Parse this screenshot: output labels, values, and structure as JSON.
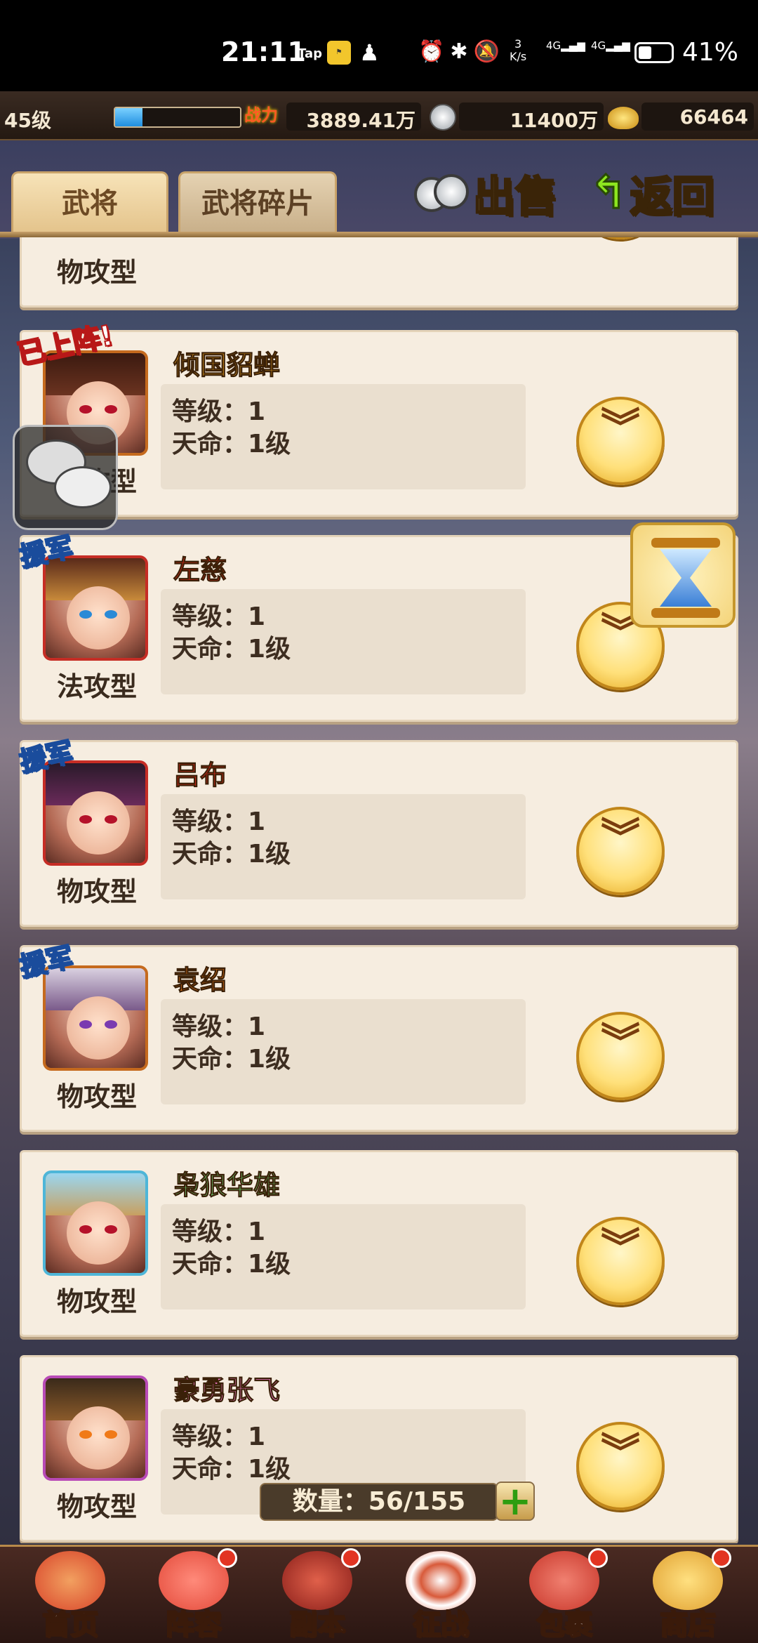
{
  "status_bar": {
    "time": "21:11",
    "tap_label": "Tap",
    "net_speed_top": "3",
    "net_speed_unit": "K/s",
    "sig1": "4G",
    "sig2": "4G",
    "battery": "41%",
    "battery_fraction": 0.41
  },
  "resources": {
    "level": "45级",
    "exp_fraction": 0.22,
    "power_label": "战力",
    "power_value": "3889.41万",
    "silver_value": "11400万",
    "gold_value": "66464"
  },
  "tabs": [
    {
      "label": "武将",
      "active": true
    },
    {
      "label": "武将碎片",
      "active": false
    }
  ],
  "actions": {
    "sell_label": "出售",
    "back_label": "返回"
  },
  "cards": [
    {
      "name": "",
      "type": "物攻型",
      "level_label": "等级：",
      "level": "1",
      "destiny_label": "天命：",
      "destiny": "1级",
      "badge": "",
      "name_color": "#000000"
    },
    {
      "name": "倾国貂蝉",
      "type": "物攻型",
      "level_label": "等级：",
      "level": "1",
      "destiny_label": "天命：",
      "destiny": "1级",
      "badge": "已上阵!",
      "name_color": "#e8a020"
    },
    {
      "name": "左慈",
      "type": "法攻型",
      "level_label": "等级：",
      "level": "1",
      "destiny_label": "天命：",
      "destiny": "1级",
      "badge": "援军",
      "name_color": "#e0261a"
    },
    {
      "name": "吕布",
      "type": "物攻型",
      "level_label": "等级：",
      "level": "1",
      "destiny_label": "天命：",
      "destiny": "1级",
      "badge": "援军",
      "name_color": "#e0261a"
    },
    {
      "name": "袁绍",
      "type": "物攻型",
      "level_label": "等级：",
      "level": "1",
      "destiny_label": "天命：",
      "destiny": "1级",
      "badge": "援军",
      "name_color": "#f07a18"
    },
    {
      "name": "枭狼华雄",
      "type": "物攻型",
      "level_label": "等级：",
      "level": "1",
      "destiny_label": "天命：",
      "destiny": "1级",
      "badge": "",
      "name_color": "#6fd67a"
    },
    {
      "name": "豪勇张飞",
      "type": "物攻型",
      "level_label": "等级：",
      "level": "1",
      "destiny_label": "天命：",
      "destiny": "1级",
      "badge": "",
      "name_color": "#f07ac8"
    }
  ],
  "count": {
    "label": "数量：",
    "value": "56/155",
    "plus": "+"
  },
  "bottom_nav": [
    {
      "label": "首页",
      "dot": false,
      "color": "#d8442a"
    },
    {
      "label": "阵容",
      "dot": true,
      "color": "#e34a3a"
    },
    {
      "label": "副本",
      "dot": true,
      "color": "#b0312a"
    },
    {
      "label": "征战",
      "dot": false,
      "color": "#d85a3a"
    },
    {
      "label": "包裹",
      "dot": true,
      "color": "#c8362a"
    },
    {
      "label": "商店",
      "dot": true,
      "color": "#e0a030"
    }
  ],
  "icons": {
    "expand": "chevrons-down-icon",
    "chat": "chat-bubbles-icon",
    "timer": "hourglass-icon"
  }
}
